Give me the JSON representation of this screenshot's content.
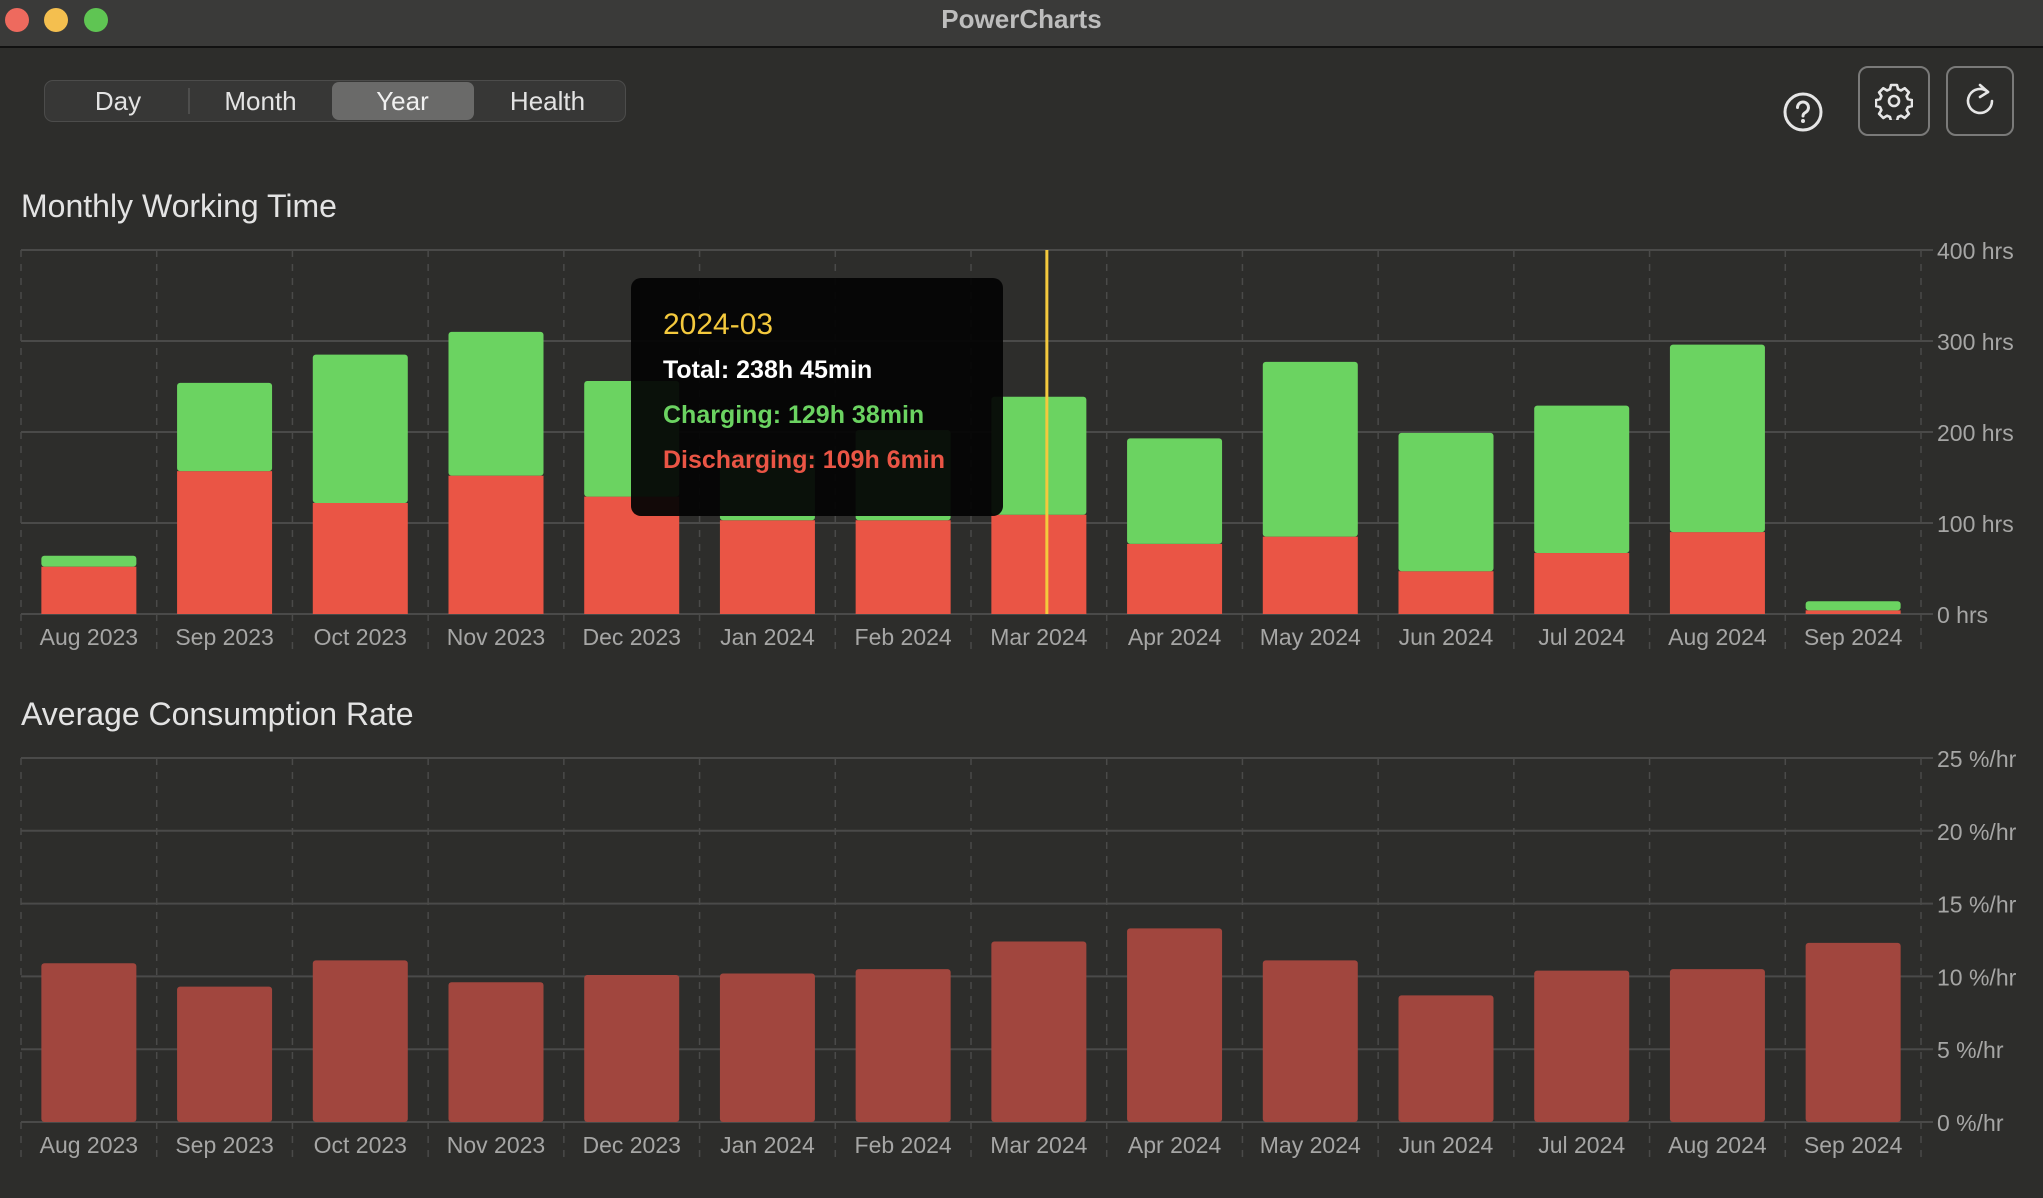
{
  "window": {
    "title": "PowerCharts"
  },
  "tabs": [
    {
      "label": "Day",
      "active": false
    },
    {
      "label": "Month",
      "active": false
    },
    {
      "label": "Year",
      "active": true
    },
    {
      "label": "Health",
      "active": false
    }
  ],
  "toolbar": {
    "help_icon": "question-circle-icon",
    "settings_icon": "gear-icon",
    "refresh_icon": "refresh-icon"
  },
  "colors": {
    "charging": "#6bd361",
    "discharging": "#ea5545",
    "rate": "#a1463e",
    "cursor": "#f4c93d",
    "grid": "#4a4a49",
    "label": "#a6a6a5"
  },
  "tooltip": {
    "date": "2024-03",
    "total": "Total: 238h 45min",
    "charging": "Charging: 129h 38min",
    "discharging": "Discharging: 109h 6min"
  },
  "chart_data": [
    {
      "type": "bar",
      "stacked": true,
      "title": "Monthly Working Time",
      "categories": [
        "Aug 2023",
        "Sep 2023",
        "Oct 2023",
        "Nov 2023",
        "Dec 2023",
        "Jan 2024",
        "Feb 2024",
        "Mar 2024",
        "Apr 2024",
        "May 2024",
        "Jun 2024",
        "Jul 2024",
        "Aug 2024",
        "Sep 2024"
      ],
      "series": [
        {
          "name": "Discharging",
          "values": [
            52,
            157,
            122,
            152,
            129,
            103,
            103,
            109.1,
            77,
            85,
            47,
            67,
            90,
            4
          ]
        },
        {
          "name": "Charging",
          "values": [
            12,
            97,
            163,
            158,
            127,
            74,
            99,
            129.63,
            116,
            192,
            152,
            162,
            206,
            10
          ]
        }
      ],
      "yticks": [
        "0 hrs",
        "100 hrs",
        "200 hrs",
        "300 hrs",
        "400 hrs"
      ],
      "ylim": [
        0,
        400
      ],
      "yaxis_position": "right",
      "grid": true,
      "highlighted_category": "Mar 2024"
    },
    {
      "type": "bar",
      "title": "Average Consumption Rate",
      "categories": [
        "Aug 2023",
        "Sep 2023",
        "Oct 2023",
        "Nov 2023",
        "Dec 2023",
        "Jan 2024",
        "Feb 2024",
        "Mar 2024",
        "Apr 2024",
        "May 2024",
        "Jun 2024",
        "Jul 2024",
        "Aug 2024",
        "Sep 2024"
      ],
      "values": [
        10.9,
        9.3,
        11.1,
        9.6,
        10.1,
        10.2,
        10.5,
        12.4,
        13.3,
        11.1,
        8.7,
        10.4,
        10.5,
        12.3
      ],
      "yticks": [
        "0 %/hr",
        "5 %/hr",
        "10 %/hr",
        "15 %/hr",
        "20 %/hr",
        "25 %/hr"
      ],
      "ylim": [
        0,
        25
      ],
      "yaxis_position": "right",
      "grid": true
    }
  ]
}
